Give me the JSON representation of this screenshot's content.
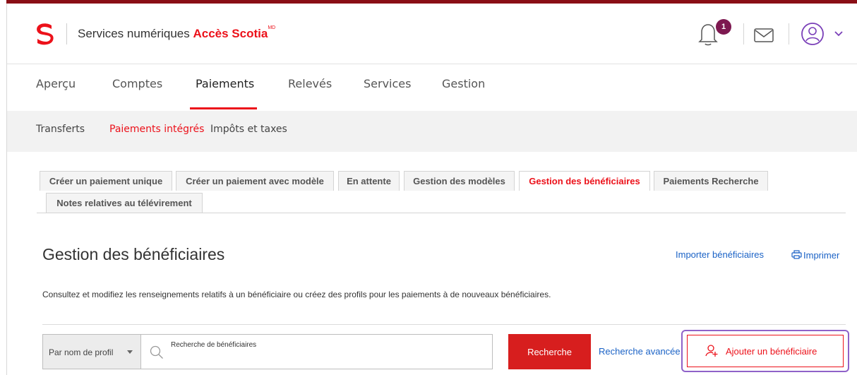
{
  "header": {
    "brand_prefix": "Services numériques",
    "brand_name": "Accès Scotia",
    "brand_mark": "MD",
    "notification_count": "1",
    "icons": [
      "scotia-logo",
      "bell-icon",
      "mail-icon",
      "user-avatar-icon",
      "chevron-down-icon"
    ],
    "accent_color": "#ec111a"
  },
  "main_nav": {
    "items": [
      "Aperçu",
      "Comptes",
      "Paiements",
      "Relevés",
      "Services",
      "Gestion"
    ],
    "active": "Paiements"
  },
  "sub_nav": {
    "items": [
      "Transferts",
      "Paiements intégrés",
      "Impôts et taxes"
    ],
    "active": "Paiements intégrés"
  },
  "tabs": {
    "items": [
      "Créer un paiement unique",
      "Créer un paiement avec modèle",
      "En attente",
      "Gestion des modèles",
      "Gestion des bénéficiaires",
      "Paiements Recherche",
      "Notes relatives au télévirement"
    ],
    "active": "Gestion des bénéficiaires"
  },
  "page": {
    "title": "Gestion des bénéficiaires",
    "import_link": "Importer bénéficiaires",
    "print_link": "Imprimer",
    "description": "Consultez et modifiez les renseignements relatifs à un bénéficiaire ou créez des profils pour les paiements à de nouveaux bénéficiaires."
  },
  "search": {
    "filter_value": "Par nom de profil",
    "placeholder": "Recherche de bénéficiaires",
    "search_button": "Recherche",
    "advanced_link": "Recherche avancée",
    "add_button": "Ajouter un bénéficiaire"
  }
}
